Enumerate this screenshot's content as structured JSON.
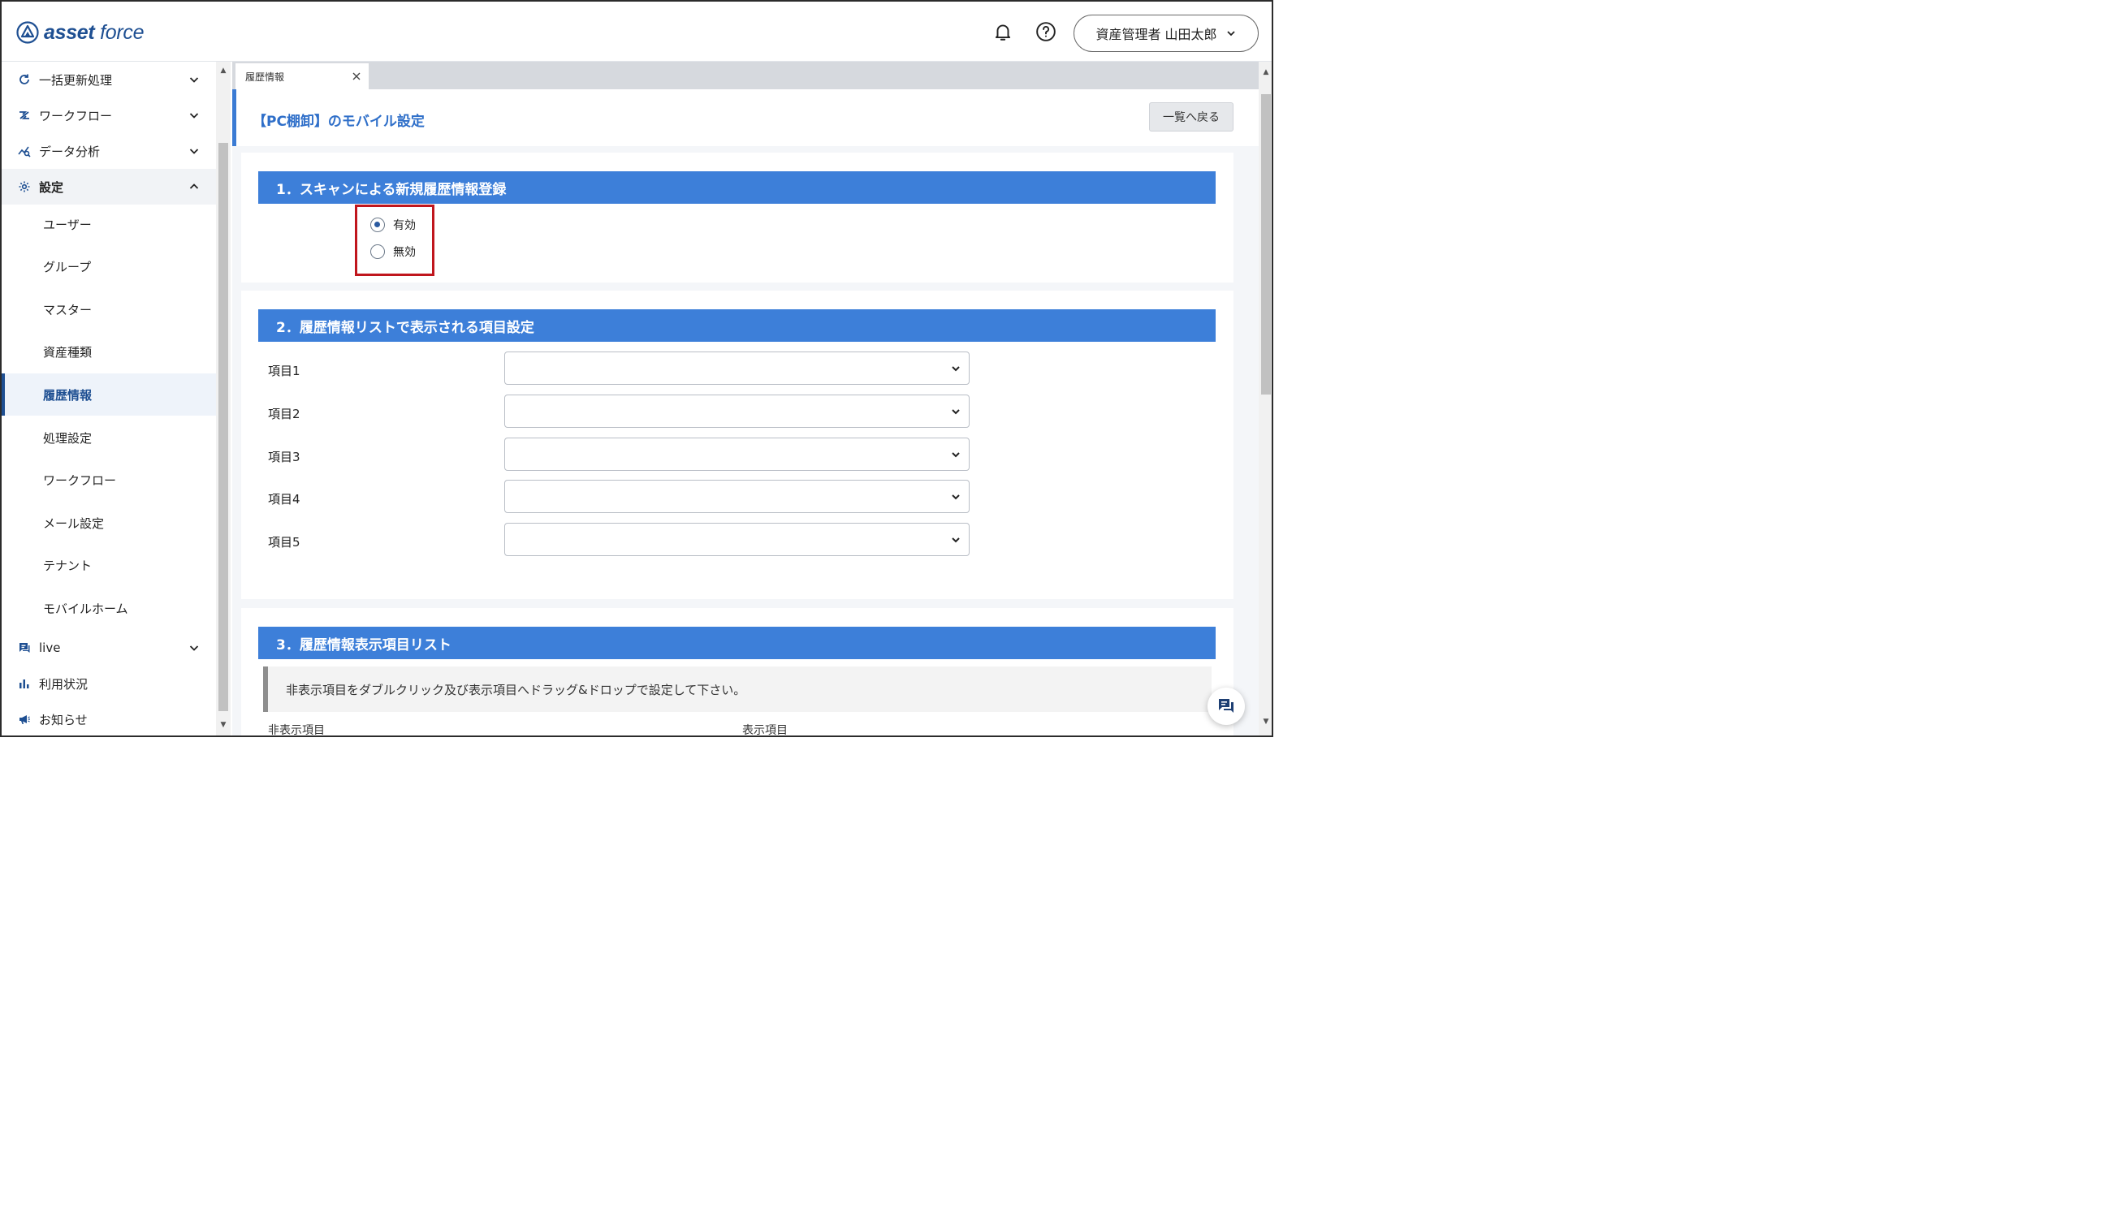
{
  "app": {
    "logo_bold": "asset",
    "logo_light": "force"
  },
  "header": {
    "user_label": "資産管理者 山田太郎"
  },
  "sidebar": {
    "top_items": [
      {
        "label": "一括更新処理",
        "icon": "refresh-icon"
      },
      {
        "label": "ワークフロー",
        "icon": "workflow-icon"
      },
      {
        "label": "データ分析",
        "icon": "analytics-icon"
      },
      {
        "label": "設定",
        "icon": "gear-icon"
      }
    ],
    "settings_items": [
      "ユーザー",
      "グループ",
      "マスター",
      "資産種類",
      "履歴情報",
      "処理設定",
      "ワークフロー",
      "メール設定",
      "テナント",
      "モバイルホーム"
    ],
    "bottom_items": [
      {
        "label": "live",
        "icon": "live-icon"
      },
      {
        "label": "利用状況",
        "icon": "bar-chart-icon"
      },
      {
        "label": "お知らせ",
        "icon": "megaphone-icon"
      }
    ],
    "active_item": "履歴情報"
  },
  "tabs": [
    {
      "label": "履歴情報"
    }
  ],
  "page": {
    "title": "【PC棚卸】のモバイル設定",
    "back_button": "一覧へ戻る"
  },
  "section1": {
    "title": "1．スキャンによる新規履歴情報登録",
    "options": [
      "有効",
      "無効"
    ],
    "selected": "有効"
  },
  "section2": {
    "title": "2．履歴情報リストで表示される項目設定",
    "fields": [
      {
        "label": "項目1",
        "value": ""
      },
      {
        "label": "項目2",
        "value": ""
      },
      {
        "label": "項目3",
        "value": ""
      },
      {
        "label": "項目4",
        "value": ""
      },
      {
        "label": "項目5",
        "value": ""
      }
    ]
  },
  "section3": {
    "title": "3．履歴情報表示項目リスト",
    "note": "非表示項目をダブルクリック及び表示項目へドラッグ&ドロップで設定して下さい。",
    "hidden_label": "非表示項目",
    "shown_label": "表示項目"
  },
  "colors": {
    "accent": "#3d7fd9",
    "brand": "#1e4f92",
    "highlight_border": "#c0161d"
  }
}
